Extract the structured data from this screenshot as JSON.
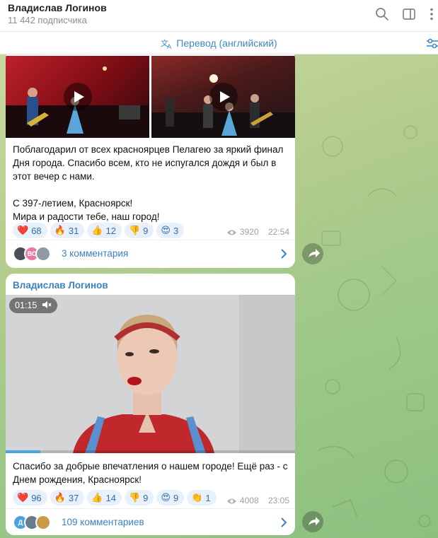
{
  "header": {
    "title": "Владислав Логинов",
    "subtitle": "11 442 подписчика",
    "icons": [
      "search-icon",
      "sidebar-toggle-icon",
      "more-vertical-icon"
    ]
  },
  "translate_bar": {
    "label": "Перевод (английский)",
    "icon": "translate-icon",
    "right_icon": "settings-sliders-icon"
  },
  "posts": [
    {
      "media": [
        {
          "type": "video",
          "icon": "play-icon"
        },
        {
          "type": "video",
          "icon": "play-icon"
        }
      ],
      "text": "Поблагодарил от всех красноярцев Пелагею за яркий финал Дня города. Спасибо всем, кто не испугался дождя и был в этот вечер с нами.\n\nС 397-летием, Красноярск!\nМира и радости тебе, наш город!",
      "reactions": [
        {
          "emoji": "❤️",
          "name": "heart",
          "count": "68"
        },
        {
          "emoji": "🔥",
          "name": "fire",
          "count": "31"
        },
        {
          "emoji": "👍",
          "name": "thumbs-up",
          "count": "12"
        },
        {
          "emoji": "👎",
          "name": "thumbs-down",
          "count": "9"
        },
        {
          "emoji": "😍",
          "name": "heart-eyes",
          "count": "3"
        }
      ],
      "views": "3920",
      "time": "22:54",
      "comments": {
        "label": "3 комментария",
        "avatars": [
          "",
          "ВС",
          ""
        ]
      }
    },
    {
      "sender": "Владислав Логинов",
      "video": {
        "duration": "01:15",
        "muted": true,
        "progress": 0.12
      },
      "text": "Спасибо за добрые впечатления о нашем городе! Ещё раз - с Днем рождения, Красноярск!",
      "reactions": [
        {
          "emoji": "❤️",
          "name": "heart",
          "count": "96"
        },
        {
          "emoji": "🔥",
          "name": "fire",
          "count": "37"
        },
        {
          "emoji": "👍",
          "name": "thumbs-up",
          "count": "14"
        },
        {
          "emoji": "👎",
          "name": "thumbs-down",
          "count": "9"
        },
        {
          "emoji": "😍",
          "name": "heart-eyes",
          "count": "9"
        },
        {
          "emoji": "👏",
          "name": "clap",
          "count": "1"
        }
      ],
      "views": "4008",
      "time": "23:05",
      "comments": {
        "label": "109 комментариев",
        "avatars": [
          "Д",
          "",
          ""
        ]
      }
    }
  ],
  "colors": {
    "accent": "#3a82c4",
    "reaction_bg": "#e8f1fb",
    "chat_bg": "#b3cc8c"
  }
}
